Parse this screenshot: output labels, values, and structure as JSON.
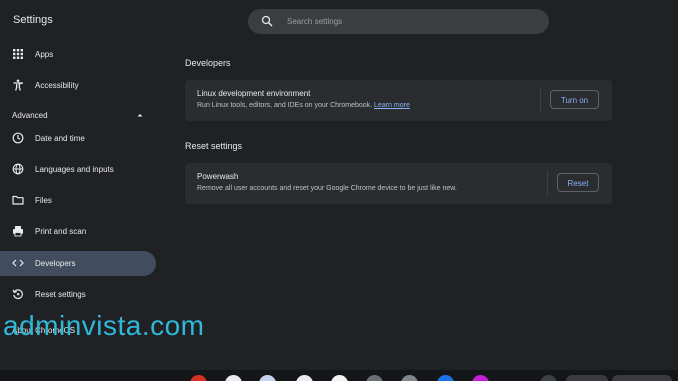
{
  "header": {
    "title": "Settings",
    "search_placeholder": "Search settings"
  },
  "sidebar": {
    "items_top": [
      {
        "label": "Apps",
        "icon": "apps-grid-icon"
      },
      {
        "label": "Accessibility",
        "icon": "accessibility-person-icon"
      }
    ],
    "advanced_label": "Advanced",
    "advanced_expanded": true,
    "items_advanced": [
      {
        "label": "Date and time",
        "icon": "clock-icon"
      },
      {
        "label": "Languages and inputs",
        "icon": "globe-icon"
      },
      {
        "label": "Files",
        "icon": "folder-icon"
      },
      {
        "label": "Print and scan",
        "icon": "printer-icon"
      },
      {
        "label": "Developers",
        "icon": "code-brackets-icon",
        "active": true
      },
      {
        "label": "Reset settings",
        "icon": "reset-icon"
      }
    ],
    "about_label": "About ChromeOS"
  },
  "main": {
    "developers": {
      "section_title": "Developers",
      "row_title": "Linux development environment",
      "row_subtitle": "Run Linux tools, editors, and IDEs on your Chromebook.",
      "learn_more": "Learn more",
      "button": "Turn on"
    },
    "reset": {
      "section_title": "Reset settings",
      "row_title": "Powerwash",
      "row_subtitle": "Remove all user accounts and reset your Google Chrome device to be just like new.",
      "button": "Reset"
    }
  },
  "watermark": "adminvista.com",
  "colors": {
    "background": "#202124",
    "card": "#2b2c30",
    "accent": "#8ab4f8",
    "active_nav": "#414d5e",
    "watermark": "#2fb8d8"
  }
}
